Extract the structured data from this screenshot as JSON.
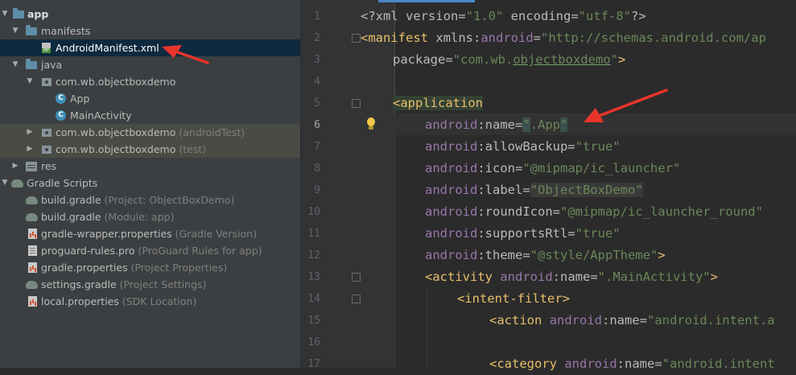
{
  "project_tree": {
    "rows": [
      {
        "label": "app",
        "hint": ""
      },
      {
        "label": "manifests",
        "hint": ""
      },
      {
        "label": "AndroidManifest.xml",
        "hint": ""
      },
      {
        "label": "java",
        "hint": ""
      },
      {
        "label": "com.wb.objectboxdemo",
        "hint": ""
      },
      {
        "label": "App",
        "hint": ""
      },
      {
        "label": "MainActivity",
        "hint": ""
      },
      {
        "label": "com.wb.objectboxdemo",
        "hint": "(androidTest)"
      },
      {
        "label": "com.wb.objectboxdemo",
        "hint": "(test)"
      },
      {
        "label": "res",
        "hint": ""
      },
      {
        "label": "Gradle Scripts",
        "hint": ""
      },
      {
        "label": "build.gradle",
        "hint": "(Project: ObjectBoxDemo)"
      },
      {
        "label": "build.gradle",
        "hint": "(Module: app)"
      },
      {
        "label": "gradle-wrapper.properties",
        "hint": "(Gradle Version)"
      },
      {
        "label": "proguard-rules.pro",
        "hint": "(ProGuard Rules for app)"
      },
      {
        "label": "gradle.properties",
        "hint": "(Project Properties)"
      },
      {
        "label": "settings.gradle",
        "hint": "(Project Settings)"
      },
      {
        "label": "local.properties",
        "hint": "(SDK Location)"
      }
    ],
    "icons": [
      "android-module-icon",
      "folder-icon",
      "manifest-file-icon",
      "folder-icon",
      "package-icon",
      "class-icon",
      "class-icon",
      "package-icon",
      "package-icon",
      "res-folder-icon",
      "gradle-icon",
      "gradle-icon",
      "gradle-icon",
      "properties-icon",
      "proguard-icon",
      "properties-icon",
      "gradle-icon",
      "properties-icon"
    ]
  },
  "editor": {
    "line_numbers": [
      "1",
      "2",
      "3",
      "4",
      "5",
      "6",
      "7",
      "8",
      "9",
      "10",
      "11",
      "12",
      "13",
      "14",
      "15",
      "16",
      "17"
    ],
    "code": {
      "l1": {
        "a": "<?xml version=",
        "b": "\"1.0\"",
        "c": " encoding=",
        "d": "\"utf-8\"",
        "e": "?>"
      },
      "l2": {
        "a": "<manifest ",
        "b": "xmlns:",
        "c": "android",
        "d": "=",
        "e": "\"http://schemas.android.com/ap"
      },
      "l3": {
        "a": "package=",
        "b": "\"com.wb.",
        "c": "objectboxdemo",
        "d": "\"",
        "e": ">"
      },
      "l5": {
        "a": "<application"
      },
      "l6": {
        "ns": "android",
        "attr": ":name=",
        "q1": "\"",
        "v": ".App",
        "q2": "\""
      },
      "l7": {
        "ns": "android",
        "attr": ":allowBackup=",
        "v": "\"true\""
      },
      "l8": {
        "ns": "android",
        "attr": ":icon=",
        "v": "\"@mipmap/ic_launcher\""
      },
      "l9": {
        "ns": "android",
        "attr": ":label=",
        "v": "\"ObjectBoxDemo\""
      },
      "l10": {
        "ns": "android",
        "attr": ":roundIcon=",
        "v": "\"@mipmap/ic_launcher_round\""
      },
      "l11": {
        "ns": "android",
        "attr": ":supportsRtl=",
        "v": "\"true\""
      },
      "l12": {
        "ns": "android",
        "attr": ":theme=",
        "v": "\"@style/AppTheme\"",
        "end": ">"
      },
      "l13": {
        "tag": "<activity ",
        "ns": "android",
        "attr": ":name=",
        "v": "\".MainActivity\"",
        "end": ">"
      },
      "l14": {
        "tag": "<intent-filter",
        "end": ">"
      },
      "l15": {
        "tag": "<action ",
        "ns": "android",
        "attr": ":name=",
        "v": "\"android.intent.a"
      },
      "l17": {
        "tag": "<category ",
        "ns": "android",
        "attr": ":name=",
        "v": "\"android.intent"
      }
    }
  },
  "colors": {
    "tree_bg": "#3c3f41",
    "editor_bg": "#2b2b2b",
    "selection": "#0d293e",
    "annotation_arrow": "#e8342b"
  }
}
